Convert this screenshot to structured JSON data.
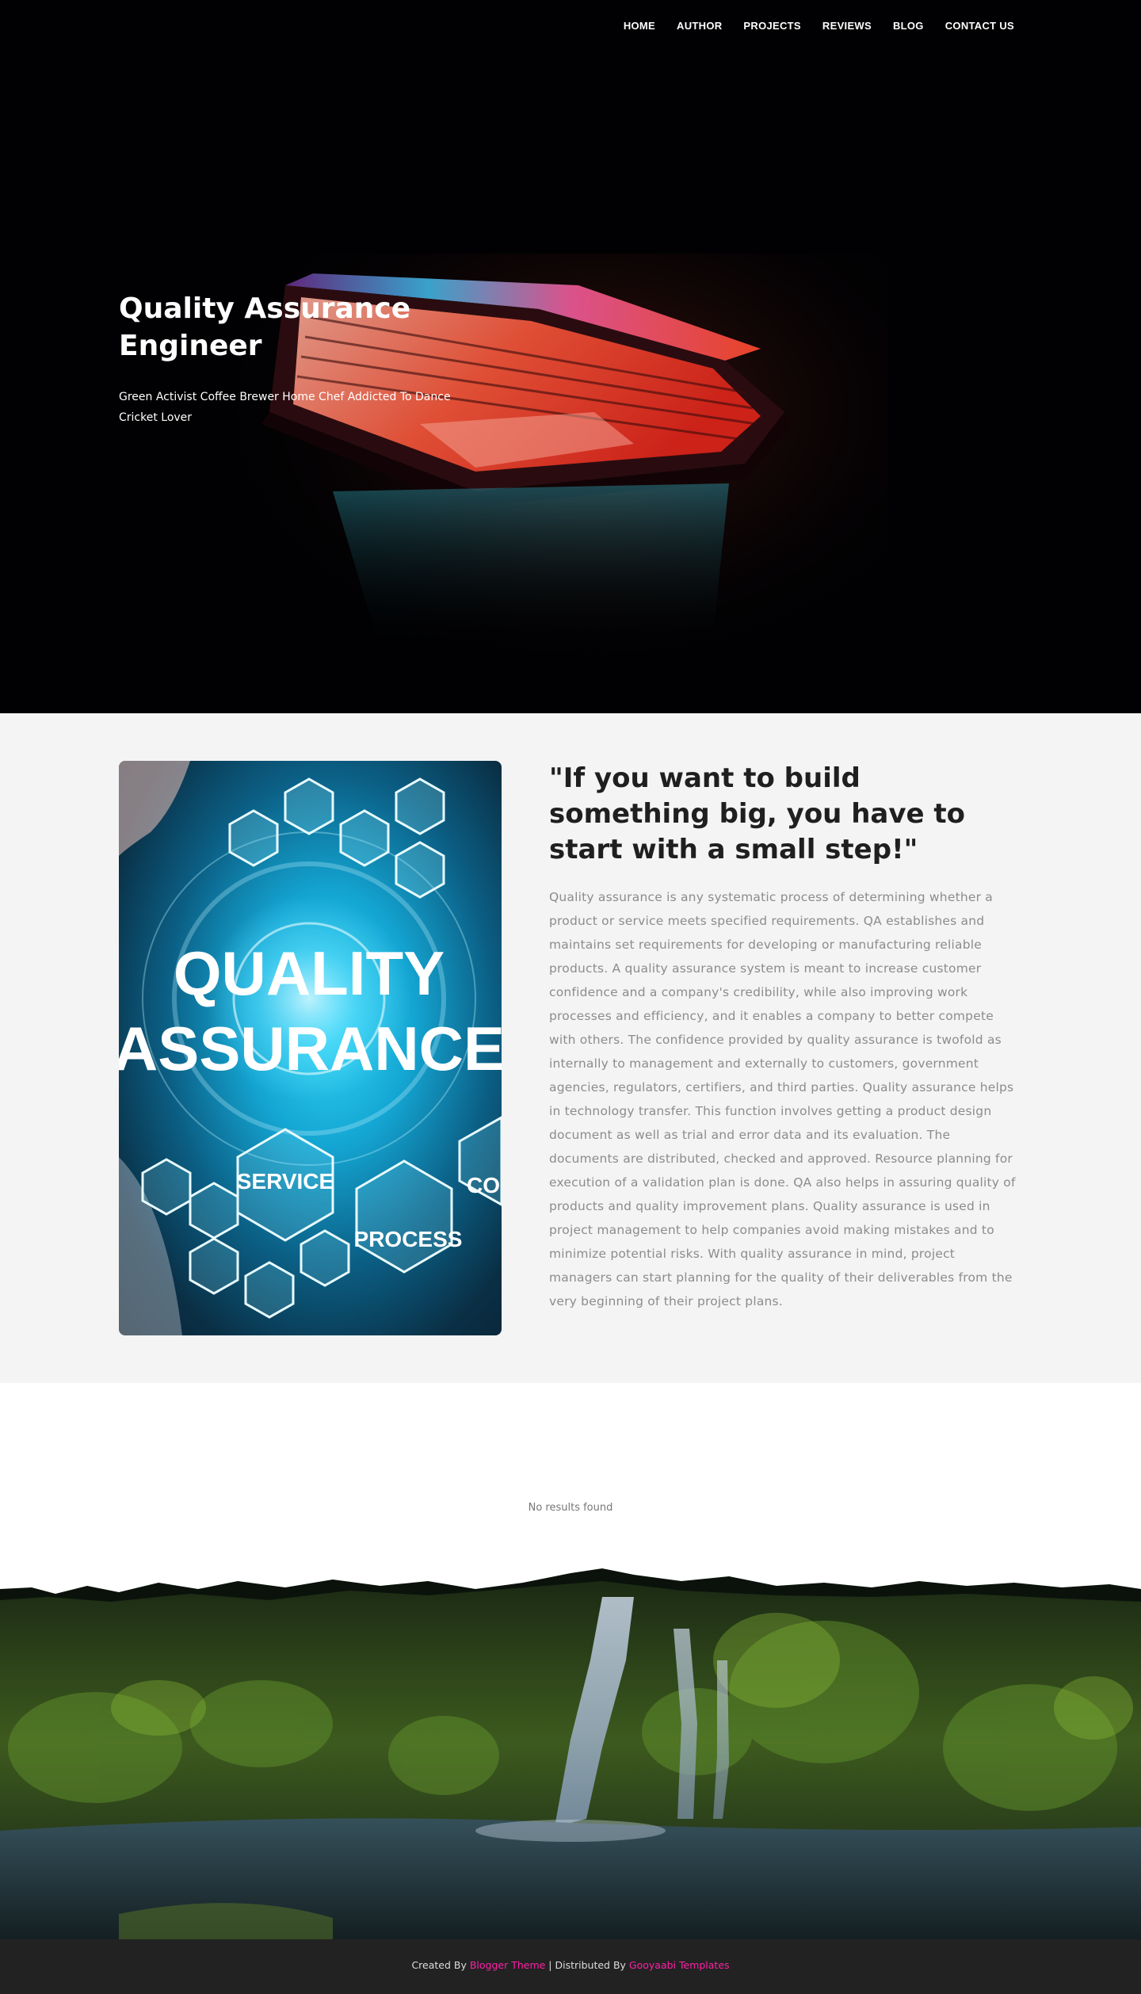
{
  "nav": {
    "items": [
      "HOME",
      "AUTHOR",
      "PROJECTS",
      "REVIEWS",
      "BLOG",
      "CONTACT US"
    ]
  },
  "hero": {
    "title": "Quality Assurance Engineer",
    "subtitle": "Green Activist Coffee Brewer Home Chef Addicted To Dance Cricket Lover"
  },
  "about": {
    "image": {
      "words": [
        "QUALITY",
        "ASSURANCE",
        "SERVICE",
        "PROCESS",
        "CO"
      ]
    },
    "quote": "\"If you want to build something big, you have to start with a small step!\"",
    "paragraph": "Quality assurance is any systematic process of determining whether a product or service meets specified requirements. QA establishes and maintains set requirements for developing or manufacturing reliable products. A quality assurance system is meant to increase customer confidence and a company's credibility, while also improving work processes and efficiency, and it enables a company to better compete with others. The confidence provided by quality assurance is twofold as internally to management and externally to customers, government agencies, regulators, certifiers, and third parties. Quality assurance helps in technology transfer. This function involves getting a product design document as well as trial and error data and its evaluation. The documents are distributed, checked and approved. Resource planning for execution of a validation plan is done. QA also helps in assuring quality of products and quality improvement plans. Quality assurance is used in project management to help companies avoid making mistakes and to minimize potential risks. With quality assurance in mind, project managers can start planning for the quality of their deliverables from the very beginning of their project plans."
  },
  "results": {
    "message": "No results found"
  },
  "footer": {
    "created_prefix": "Created By ",
    "created_link": "Blogger Theme",
    "separator": " | Distributed By ",
    "distributed_link": "Gooyaabi Templates"
  },
  "colors": {
    "hero_bg": "#010103",
    "about_bg": "#f4f4f4",
    "footer_bg": "#222222",
    "footer_link": "#ff20a6"
  }
}
